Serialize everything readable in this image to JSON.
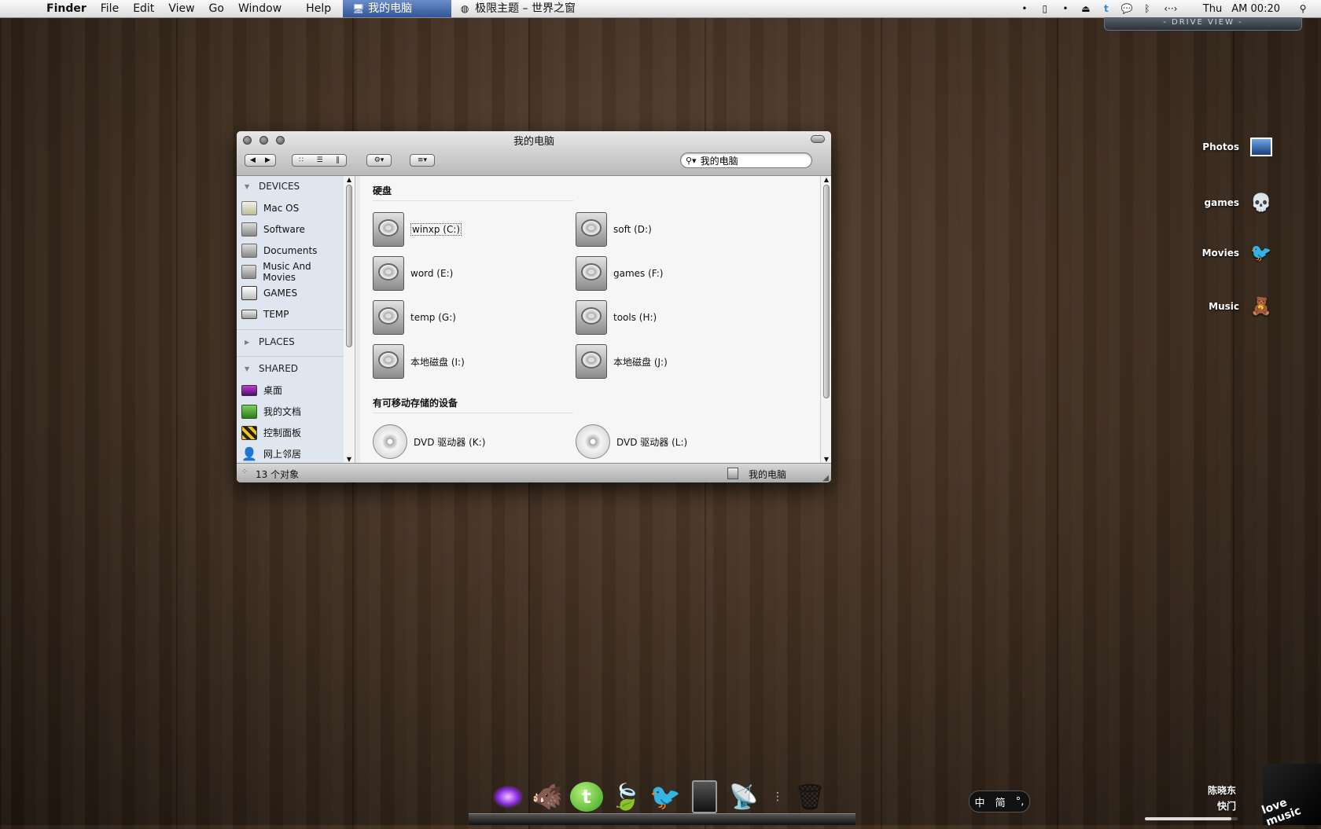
{
  "menubar": {
    "app": "Finder",
    "items": [
      "File",
      "Edit",
      "View",
      "Go",
      "Window",
      "Help"
    ],
    "active_window": "我的电脑",
    "second_tab": "极限主题 – 世界之窗",
    "day": "Thu",
    "time": "AM 00:20",
    "status_icons": [
      "bullet-icon",
      "phone-icon",
      "bullet-icon",
      "eject-icon",
      "twitter-icon",
      "chat-icon",
      "bluetooth-icon",
      "network-arrows-icon",
      "spotlight-icon"
    ]
  },
  "drive_view": {
    "label": "- DRIVE VIEW -"
  },
  "window": {
    "title": "我的电脑",
    "search_value": "我的电脑",
    "sidebar": {
      "devices_header": "DEVICES",
      "devices": [
        "Mac OS",
        "Software",
        "Documents",
        "Music And Movies",
        "GAMES",
        "TEMP"
      ],
      "places_header": "PLACES",
      "shared_header": "SHARED",
      "shared": [
        "桌面",
        "我的文档",
        "控制面板",
        "网上邻居"
      ]
    },
    "sections": {
      "hdd_title": "硬盘",
      "drives": [
        "winxp (C:)",
        "soft (D:)",
        "word (E:)",
        "games (F:)",
        "temp (G:)",
        "tools (H:)",
        "本地磁盘 (I:)",
        "本地磁盘 (J:)"
      ],
      "removable_title": "有可移动存储的设备",
      "removable": [
        "DVD 驱动器 (K:)",
        "DVD 驱动器 (L:)"
      ]
    },
    "status": {
      "count": "13 个对象",
      "location": "我的电脑"
    }
  },
  "desktop": {
    "items": [
      {
        "label": "Photos",
        "icon": "photo-icon"
      },
      {
        "label": "games",
        "icon": "skull-icon"
      },
      {
        "label": "Movies",
        "icon": "bird-icon"
      },
      {
        "label": "Music",
        "icon": "teddy-bear-icon"
      }
    ]
  },
  "dock": {
    "icons": [
      "fireworks-icon",
      "boar-icon",
      "chat-bubble-icon",
      "leaf-icon",
      "bird-nest-icon",
      "ipad-icon",
      "airport-icon",
      "trash-icon"
    ]
  },
  "ime": {
    "chars": [
      "中",
      "简",
      "°,"
    ]
  },
  "now_playing": {
    "artist": "陈晓东",
    "song": "快门",
    "album_text": "love music",
    "progress": 0.93
  },
  "colors": {
    "menu_active": "#3d5fa2",
    "sidebar_bg": "#dfe6ef",
    "wood": "#3a2a1d"
  }
}
